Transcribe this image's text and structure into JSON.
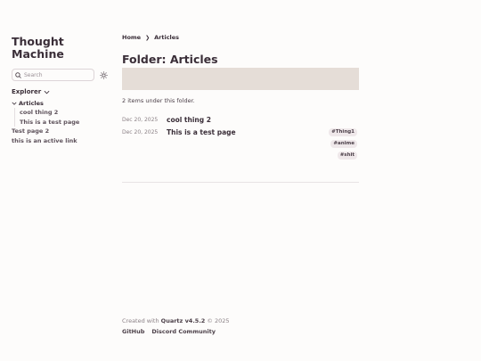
{
  "site": {
    "title_line1": "Thought",
    "title_line2": "Machine"
  },
  "search": {
    "placeholder": "Search"
  },
  "explorer": {
    "label": "Explorer",
    "folder": {
      "label": "Articles",
      "children": [
        "cool thing 2",
        "This is a test page"
      ]
    },
    "items": [
      "Test page 2",
      "this is an active link"
    ]
  },
  "breadcrumb": {
    "home": "Home",
    "separator": "❯",
    "current": "Articles"
  },
  "page": {
    "title": "Folder: Articles",
    "count_text": "2 items under this folder."
  },
  "list": [
    {
      "date": "Dec 20, 2025",
      "title": "cool thing 2",
      "tags": []
    },
    {
      "date": "Dec 20, 2025",
      "title": "This is a test page",
      "tags": [
        "#Thing1",
        "#anime",
        "#shit"
      ]
    }
  ],
  "footer": {
    "created_prefix": "Created with",
    "generator": "Quartz v4.5.2",
    "copyright": "© 2025",
    "links": [
      "GitHub",
      "Discord Community"
    ]
  }
}
